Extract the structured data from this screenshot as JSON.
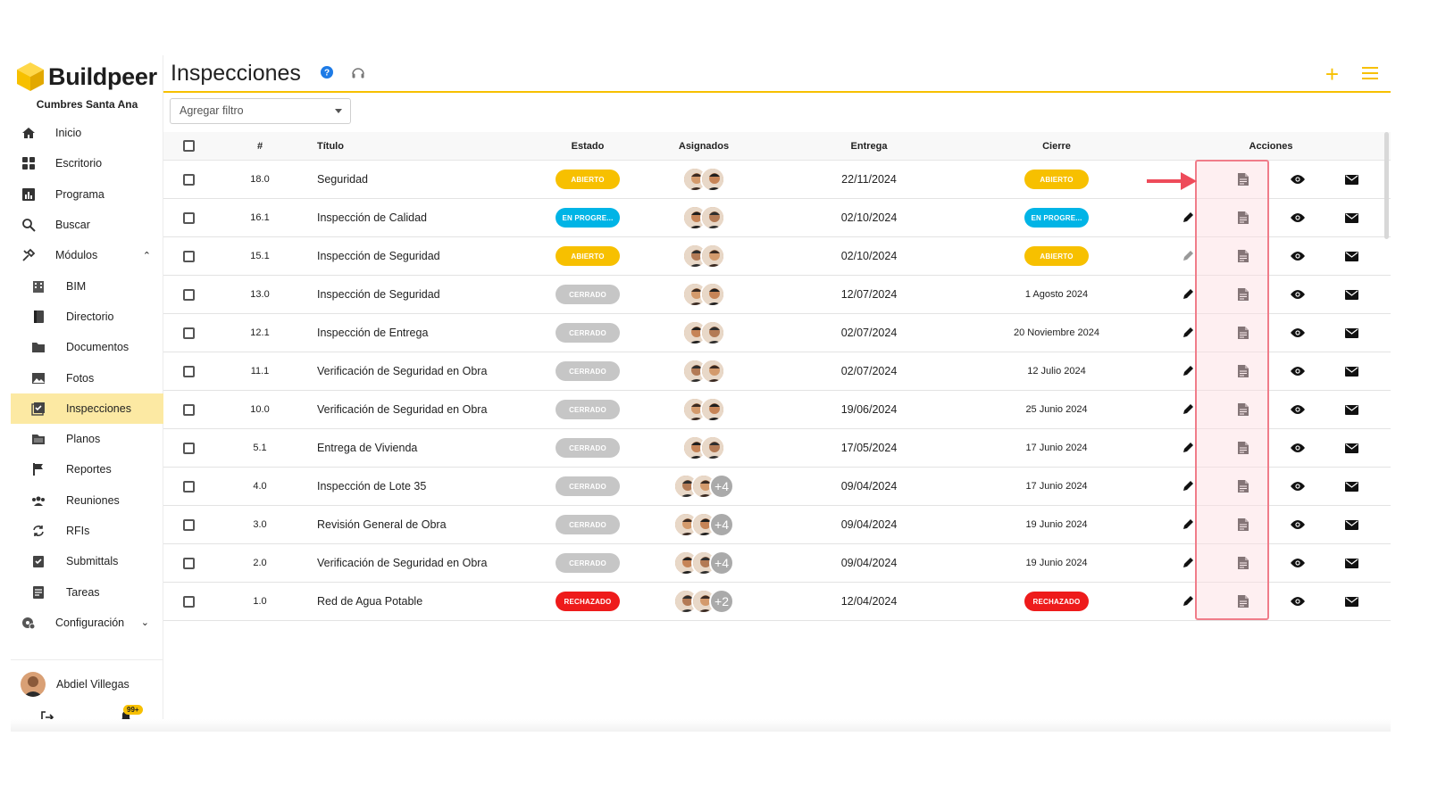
{
  "brand": {
    "name": "Buildpeer",
    "project": "Cumbres Santa Ana",
    "accent": "#f7c000"
  },
  "sidebar": {
    "items": [
      {
        "label": "Inicio",
        "icon": "home-icon"
      },
      {
        "label": "Escritorio",
        "icon": "dashboard-icon"
      },
      {
        "label": "Programa",
        "icon": "chart-icon"
      },
      {
        "label": "Buscar",
        "icon": "search-icon"
      },
      {
        "label": "Módulos",
        "icon": "tools-icon"
      }
    ],
    "modules": [
      {
        "label": "BIM",
        "icon": "building-icon"
      },
      {
        "label": "Directorio",
        "icon": "contacts-icon"
      },
      {
        "label": "Documentos",
        "icon": "folder-icon"
      },
      {
        "label": "Fotos",
        "icon": "image-icon"
      },
      {
        "label": "Inspecciones",
        "icon": "checklist-icon",
        "active": true
      },
      {
        "label": "Planos",
        "icon": "plans-icon"
      },
      {
        "label": "Reportes",
        "icon": "flag-icon"
      },
      {
        "label": "Reuniones",
        "icon": "group-icon"
      },
      {
        "label": "RFIs",
        "icon": "sync-icon"
      },
      {
        "label": "Submittals",
        "icon": "clipboard-check-icon"
      },
      {
        "label": "Tareas",
        "icon": "task-icon"
      }
    ],
    "config": {
      "label": "Configuración",
      "icon": "settings-icon"
    },
    "user": {
      "name": "Abdiel Villegas",
      "notifications": "99+"
    }
  },
  "header": {
    "title": "Inspecciones"
  },
  "filter": {
    "placeholder": "Agregar filtro"
  },
  "table": {
    "columns": {
      "num": "#",
      "title": "Título",
      "estado": "Estado",
      "asignados": "Asignados",
      "entrega": "Entrega",
      "cierre": "Cierre",
      "acciones": "Acciones"
    },
    "status_colors": {
      "ABIERTO": "#f7c000",
      "EN PROGRE...": "#00b4e6",
      "CERRADO": "#c6c6c6",
      "RECHAZADO": "#ee1b1b"
    },
    "rows": [
      {
        "num": "18.0",
        "title": "Seguridad",
        "estado": "ABIERTO",
        "assignees": 2,
        "more": "",
        "entrega": "22/11/2024",
        "cierre": "ABIERTO",
        "cierre_is_status": true,
        "edit": false
      },
      {
        "num": "16.1",
        "title": "Inspección de Calidad",
        "estado": "EN PROGRE...",
        "assignees": 2,
        "more": "",
        "entrega": "02/10/2024",
        "cierre": "EN PROGRE...",
        "cierre_is_status": true,
        "edit": true
      },
      {
        "num": "15.1",
        "title": "Inspección de Seguridad",
        "estado": "ABIERTO",
        "assignees": 2,
        "more": "",
        "entrega": "02/10/2024",
        "cierre": "ABIERTO",
        "cierre_is_status": true,
        "edit": true,
        "edit_muted": true
      },
      {
        "num": "13.0",
        "title": "Inspección de Seguridad",
        "estado": "CERRADO",
        "assignees": 2,
        "more": "",
        "entrega": "12/07/2024",
        "cierre": "1 Agosto 2024",
        "cierre_is_status": false,
        "edit": true
      },
      {
        "num": "12.1",
        "title": "Inspección de Entrega",
        "estado": "CERRADO",
        "assignees": 2,
        "more": "",
        "entrega": "02/07/2024",
        "cierre": "20 Noviembre 2024",
        "cierre_is_status": false,
        "edit": true
      },
      {
        "num": "11.1",
        "title": "Verificación de Seguridad en Obra",
        "estado": "CERRADO",
        "assignees": 2,
        "more": "",
        "entrega": "02/07/2024",
        "cierre": "12 Julio 2024",
        "cierre_is_status": false,
        "edit": true
      },
      {
        "num": "10.0",
        "title": "Verificación de Seguridad en Obra",
        "estado": "CERRADO",
        "assignees": 2,
        "more": "",
        "entrega": "19/06/2024",
        "cierre": "25 Junio 2024",
        "cierre_is_status": false,
        "edit": true
      },
      {
        "num": "5.1",
        "title": "Entrega de Vivienda",
        "estado": "CERRADO",
        "assignees": 2,
        "more": "",
        "entrega": "17/05/2024",
        "cierre": "17 Junio 2024",
        "cierre_is_status": false,
        "edit": true
      },
      {
        "num": "4.0",
        "title": "Inspección de Lote 35",
        "estado": "CERRADO",
        "assignees": 2,
        "more": "+4",
        "entrega": "09/04/2024",
        "cierre": "17 Junio 2024",
        "cierre_is_status": false,
        "edit": true
      },
      {
        "num": "3.0",
        "title": "Revisión General de Obra",
        "estado": "CERRADO",
        "assignees": 2,
        "more": "+4",
        "entrega": "09/04/2024",
        "cierre": "19 Junio 2024",
        "cierre_is_status": false,
        "edit": true
      },
      {
        "num": "2.0",
        "title": "Verificación de Seguridad en Obra",
        "estado": "CERRADO",
        "assignees": 2,
        "more": "+4",
        "entrega": "09/04/2024",
        "cierre": "19 Junio 2024",
        "cierre_is_status": false,
        "edit": true
      },
      {
        "num": "1.0",
        "title": "Red de Agua Potable",
        "estado": "RECHAZADO",
        "assignees": 2,
        "more": "+2",
        "entrega": "12/04/2024",
        "cierre": "RECHAZADO",
        "cierre_is_status": true,
        "edit": true
      }
    ]
  },
  "annotation": {
    "highlight_color": "#f07d8a",
    "arrow_color": "#ee4b5a"
  }
}
